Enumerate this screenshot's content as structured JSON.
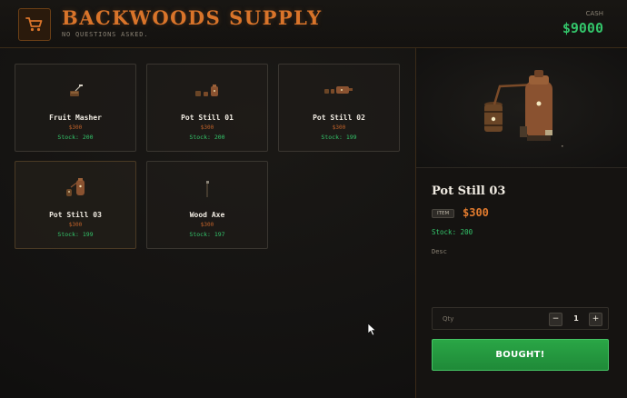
{
  "header": {
    "title": "BACKWOODS SUPPLY",
    "subtitle": "NO QUESTIONS ASKED.",
    "cash_label": "CASH",
    "cash_value": "$9000",
    "logo_icon": "shopping-cart-icon"
  },
  "colors": {
    "accent": "#d9742a",
    "cash_green": "#33c46a",
    "price_orange": "#c0622a",
    "buy_button": "#2aa646"
  },
  "products": [
    {
      "name": "Fruit Masher",
      "price": "$300",
      "stock": "Stock: 200",
      "icon": "fruit-masher-icon"
    },
    {
      "name": "Pot Still 01",
      "price": "$300",
      "stock": "Stock: 200",
      "icon": "pot-still-icon"
    },
    {
      "name": "Pot Still 02",
      "price": "$300",
      "stock": "Stock: 199",
      "icon": "pot-still-icon"
    },
    {
      "name": "Pot Still 03",
      "price": "$300",
      "stock": "Stock: 199",
      "icon": "pot-still-icon"
    },
    {
      "name": "Wood Axe",
      "price": "$300",
      "stock": "Stock: 197",
      "icon": "axe-icon"
    }
  ],
  "detail": {
    "name": "Pot Still 03",
    "tag": "ITEM",
    "price": "$300",
    "stock": "Stock: 200",
    "desc": "Desc",
    "qty_label": "Qty",
    "qty_minus": "−",
    "qty_value": "1",
    "qty_plus": "+",
    "buy_label": "BOUGHT!"
  }
}
